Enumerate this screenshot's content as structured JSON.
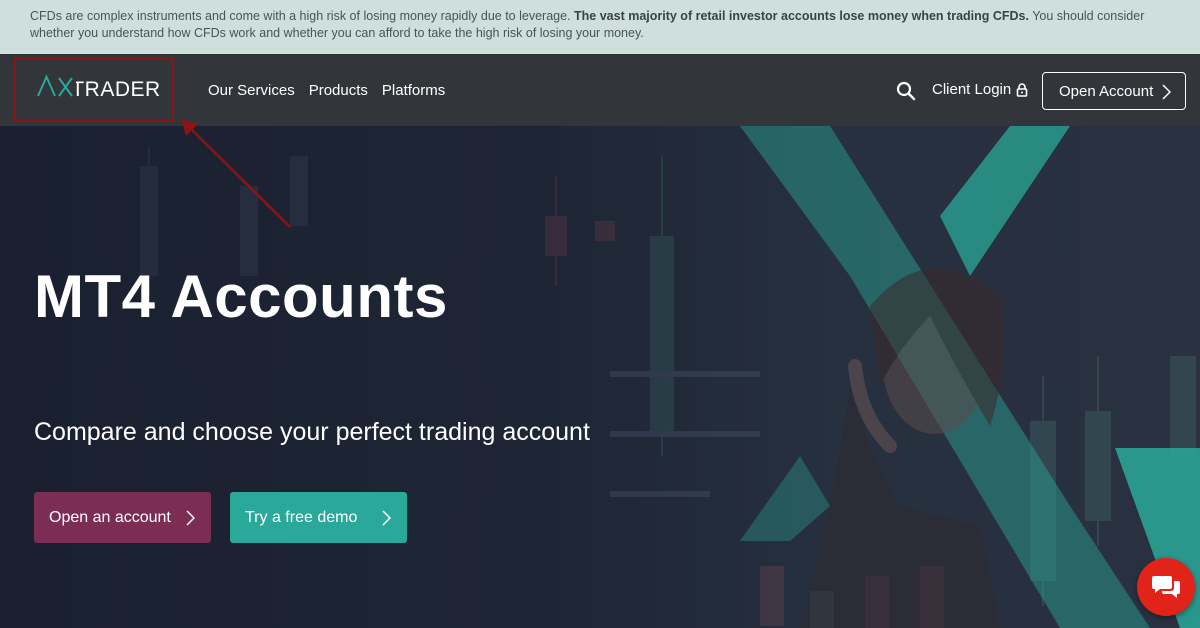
{
  "risk_warning": {
    "text_before": "CFDs are complex instruments and come with a high risk of losing money rapidly due to leverage. ",
    "text_bold": "The vast majority of retail investor accounts lose money when trading CFDs.",
    "text_after": " You should consider whether you understand how CFDs work and whether you can afford to take the high risk of losing your money."
  },
  "header": {
    "logo_text": "AXITRADER",
    "nav": [
      "Our Services",
      "Products",
      "Platforms"
    ],
    "client_login": "Client Login",
    "open_account": "Open Account"
  },
  "hero": {
    "title": "MT4 Accounts",
    "subtitle": "Compare and choose your perfect trading account",
    "cta_open": "Open an account",
    "cta_demo": "Try a free demo"
  },
  "colors": {
    "risk_bar": "#cfdfdc",
    "navbar": "#32353a",
    "cta_open": "#7b2d53",
    "cta_demo": "#2aa89a",
    "annotation": "#8b1416",
    "chat": "#e2231a"
  },
  "icons": [
    "search-icon",
    "lock-icon",
    "chevron-right-icon",
    "chat-icon"
  ]
}
